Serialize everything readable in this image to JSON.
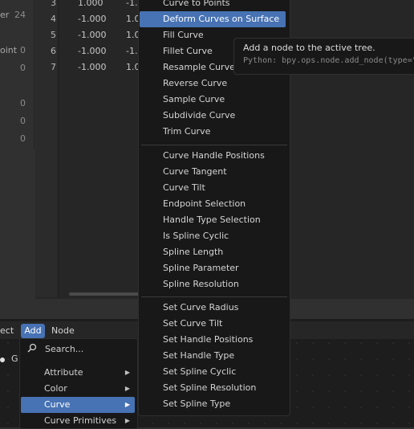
{
  "spreadsheet": {
    "left_rows": [
      {
        "label": "er",
        "value": "24"
      },
      {
        "label": "",
        "value": ""
      },
      {
        "label": "",
        "value": ""
      },
      {
        "label": "oint",
        "value": "0"
      },
      {
        "label": "",
        "value": "0"
      },
      {
        "label": "",
        "value": ""
      },
      {
        "label": "",
        "value": "0"
      },
      {
        "label": "",
        "value": "0"
      },
      {
        "label": "",
        "value": "0"
      }
    ],
    "rows": [
      {
        "index": "3",
        "col1": "1.000",
        "col2": "-1.0"
      },
      {
        "index": "4",
        "col1": "-1.000",
        "col2": "1.0"
      },
      {
        "index": "5",
        "col1": "-1.000",
        "col2": "1.0"
      },
      {
        "index": "6",
        "col1": "-1.000",
        "col2": "-1.0"
      },
      {
        "index": "7",
        "col1": "-1.000",
        "col2": "1.0"
      }
    ]
  },
  "header": {
    "select_label": "ect",
    "add_label": "Add",
    "node_label": "Node"
  },
  "editor": {
    "frame_label": "G"
  },
  "add_menu": {
    "search_placeholder": "Search...",
    "search_icon": "magnifier-icon",
    "categories": [
      {
        "label": "Attribute"
      },
      {
        "label": "Color"
      },
      {
        "label": "Curve"
      },
      {
        "label": "Curve Primitives"
      }
    ],
    "active_category": "Curve",
    "submenu_arrow": "▶"
  },
  "curve_menu": {
    "group1": [
      "Curve to Points",
      "Deform Curves on Surface",
      "Fill Curve",
      "Fillet Curve",
      "Resample Curve",
      "Reverse Curve",
      "Sample Curve",
      "Subdivide Curve",
      "Trim Curve"
    ],
    "group2": [
      "Curve Handle Positions",
      "Curve Tangent",
      "Curve Tilt",
      "Endpoint Selection",
      "Handle Type Selection",
      "Is Spline Cyclic",
      "Spline Length",
      "Spline Parameter",
      "Spline Resolution"
    ],
    "group3": [
      "Set Curve Radius",
      "Set Curve Tilt",
      "Set Handle Positions",
      "Set Handle Type",
      "Set Spline Cyclic",
      "Set Spline Resolution",
      "Set Spline Type"
    ],
    "highlighted": "Deform Curves on Surface"
  },
  "tooltip": {
    "description": "Add a node to the active tree.",
    "python": "Python: bpy.ops.node.add_node(type=\""
  },
  "colors": {
    "accent": "#4772b3",
    "menu_bg": "#181818",
    "editor_bg": "#1d1d1d"
  }
}
